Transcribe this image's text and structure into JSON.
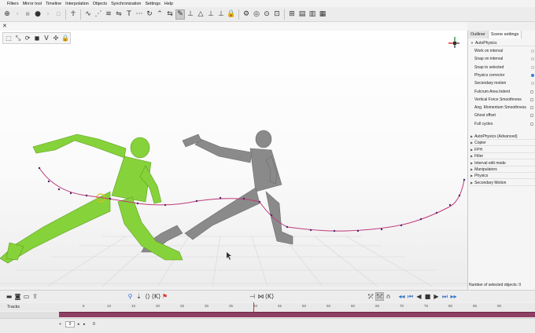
{
  "menu": [
    "Filters",
    "Mirror tool",
    "Timeline",
    "Interpolation",
    "Objects",
    "Synchronization",
    "Settings",
    "Help"
  ],
  "panel": {
    "tabs": [
      "Outliner",
      "Scene settings"
    ],
    "active_tab": "Scene settings",
    "autophysics_header": "AutoPhysics",
    "properties": [
      {
        "label": "Work on interval",
        "control": "radio",
        "on": false
      },
      {
        "label": "Snap on interval",
        "control": "radio",
        "on": false
      },
      {
        "label": "Snap to selected",
        "control": "radio",
        "on": false
      },
      {
        "label": "Physics corrector",
        "control": "radio",
        "on": true
      },
      {
        "label": "Secondary motion",
        "control": "radio",
        "on": false
      },
      {
        "label": "Fulcrum Area Indent",
        "control": "check",
        "on": false
      },
      {
        "label": "Vertical Force Smoothness",
        "control": "check",
        "on": false
      },
      {
        "label": "Ang. Momentum Smoothness",
        "control": "check",
        "on": false
      },
      {
        "label": "Ghost offset",
        "control": "check",
        "on": false
      },
      {
        "label": "Full cycles",
        "control": "check",
        "on": false
      }
    ],
    "sections": [
      "AutoPhysics (Advanced)",
      "Copier",
      "FPH",
      "Filter",
      "Interval edit mode",
      "Manipulators",
      "Physics",
      "Secondary Motion"
    ],
    "selected_count": "Number of selected objects: 0"
  },
  "timeline": {
    "tracks_label": "Tracks",
    "current_frame_marker": "40",
    "ruler_ticks": [
      "5",
      "10",
      "15",
      "20",
      "25",
      "30",
      "35",
      "40",
      "45",
      "50",
      "55",
      "60",
      "65",
      "70",
      "75",
      "80",
      "85",
      "90"
    ],
    "frame_value": "0",
    "end_value": "0"
  },
  "colors": {
    "accent_green": "#86d23a",
    "ghost_gray": "#8a8a8a",
    "trajectory": "#c03a7a",
    "timeline_track": "#8f3f63",
    "playhead": "#d33"
  }
}
